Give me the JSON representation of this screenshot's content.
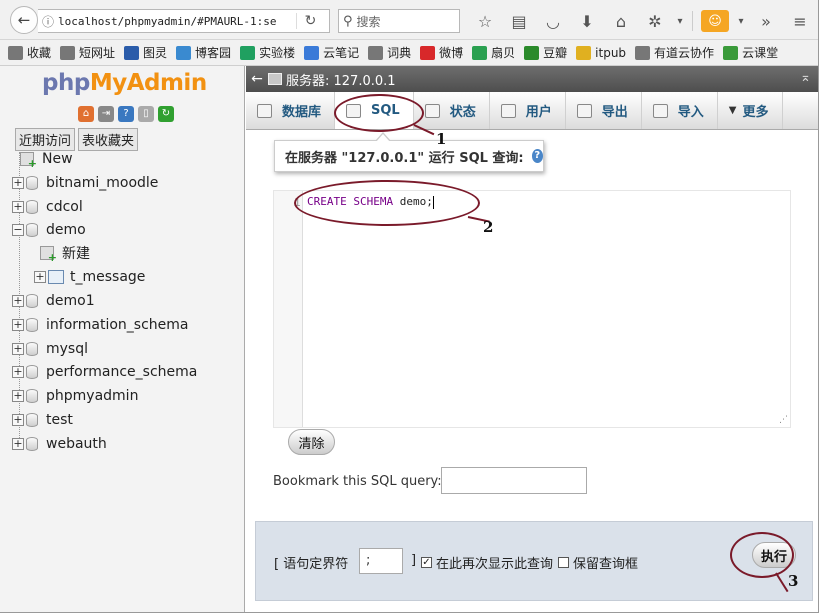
{
  "browser": {
    "url": "localhost/phpmyadmin/#PMAURL-1:se",
    "search_placeholder": "搜索",
    "bookmarks": [
      {
        "label": "收藏",
        "icon": "star-icon",
        "color": "#777777"
      },
      {
        "label": "短网址",
        "icon": "globe-icon",
        "color": "#777777"
      },
      {
        "label": "图灵",
        "icon": "turing-icon",
        "color": "#2a5caa"
      },
      {
        "label": "博客园",
        "icon": "cnblogs-icon",
        "color": "#3a8ad0"
      },
      {
        "label": "实验楼",
        "icon": "shiyanlou-icon",
        "color": "#20a060"
      },
      {
        "label": "云笔记",
        "icon": "note-icon",
        "color": "#3a7ad8"
      },
      {
        "label": "词典",
        "icon": "globe-icon",
        "color": "#777777"
      },
      {
        "label": "微博",
        "icon": "weibo-icon",
        "color": "#d8282a"
      },
      {
        "label": "扇贝",
        "icon": "shanbay-icon",
        "color": "#2aa050"
      },
      {
        "label": "豆瓣",
        "icon": "douban-icon",
        "color": "#2a8a2a"
      },
      {
        "label": "itpub",
        "icon": "itpub-icon",
        "color": "#e0b020"
      },
      {
        "label": "有道云协作",
        "icon": "globe-icon",
        "color": "#777777"
      },
      {
        "label": "云课堂",
        "icon": "book-icon",
        "color": "#3a9a3a"
      }
    ]
  },
  "logo": {
    "php": "php",
    "my": "My",
    "admin": "Admin"
  },
  "left_tabs": {
    "recent": "近期访问",
    "favorites": "表收藏夹"
  },
  "tree": {
    "new_label": "New",
    "databases": [
      "bitnami_moodle",
      "cdcol",
      "demo",
      "demo1",
      "information_schema",
      "mysql",
      "performance_schema",
      "phpmyadmin",
      "test",
      "webauth"
    ],
    "demo_children": {
      "new": "新建",
      "table": "t_message"
    }
  },
  "header": {
    "server": "服务器: 127.0.0.1"
  },
  "tabs": [
    {
      "label": "数据库",
      "icon": "database-icon"
    },
    {
      "label": "SQL",
      "icon": "sql-icon",
      "active": true
    },
    {
      "label": "状态",
      "icon": "status-icon"
    },
    {
      "label": "用户",
      "icon": "users-icon"
    },
    {
      "label": "导出",
      "icon": "export-icon"
    },
    {
      "label": "导入",
      "icon": "import-icon"
    },
    {
      "label": "更多",
      "icon": "chevron-down-icon"
    }
  ],
  "query_panel": {
    "title": "在服务器 \"127.0.0.1\" 运行 SQL 查询:",
    "line_number": "1",
    "sql_keyword": "CREATE SCHEMA",
    "sql_rest": " demo;",
    "clear_label": "清除",
    "bookmark_label": "Bookmark this SQL query:",
    "bookmark_value": ""
  },
  "footer": {
    "delimiter_label": "[ 语句定界符",
    "delimiter_value": ";",
    "bracket_close": "]",
    "show_query_label": "在此再次显示此查询",
    "show_query_checked": true,
    "keep_box_label": "保留查询框",
    "keep_box_checked": false,
    "go_label": "执行"
  },
  "annotations": {
    "a1": "1",
    "a2": "2",
    "a3": "3"
  },
  "colors": {
    "accent": "#235a81",
    "annotation": "#7a1a2a",
    "footer_bg": "#dae1ea"
  }
}
